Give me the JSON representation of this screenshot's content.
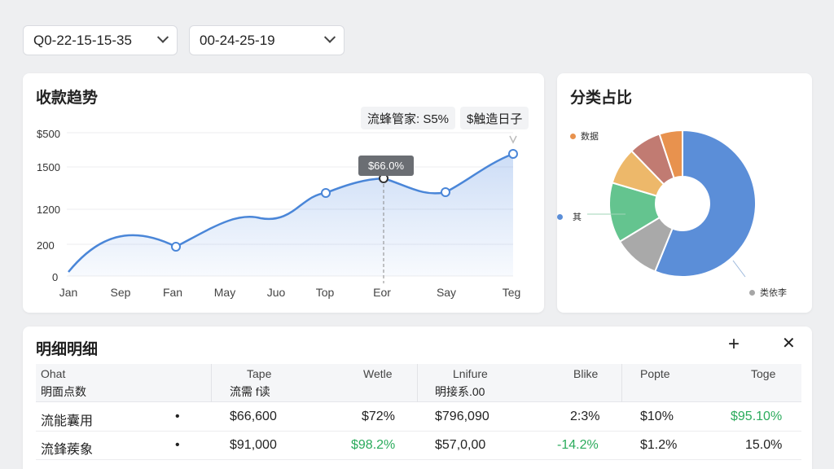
{
  "filters": [
    {
      "value": "Q0-22-15-15-35"
    },
    {
      "value": "00-24-25-19"
    }
  ],
  "trend_card": {
    "title": "收款趋势",
    "pill_ratio": "流蜂管家: S5%",
    "pill_date": "$触造日子",
    "tooltip": "$66.0%"
  },
  "pie_card": {
    "title": "分类占比",
    "legend": [
      {
        "label": "数据",
        "color": "#e8924e"
      },
      {
        "label": "其",
        "color": "#5b8ed8"
      },
      {
        "label": "类依李",
        "color": "#a6a6a6"
      }
    ]
  },
  "chart_data": [
    {
      "type": "area",
      "title": "收款趋势",
      "y_ticks": [
        "$500",
        "1500",
        "1200",
        "200",
        "0"
      ],
      "categories": [
        "Jan",
        "Sep",
        "Fan",
        "May",
        "Juo",
        "Top",
        "Eor",
        "Say",
        "Teg"
      ],
      "series": [
        {
          "values": [
            0,
            580,
            480,
            820,
            860,
            1340,
            1420,
            1370,
            1680
          ]
        }
      ]
    },
    {
      "type": "pie",
      "title": "分类占比",
      "slices": [
        {
          "value": 55,
          "color": "#5b8ed8"
        },
        {
          "value": 10,
          "color": "#a9a9a9"
        },
        {
          "value": 13,
          "color": "#64c48f"
        },
        {
          "value": 8,
          "color": "#edb86a"
        },
        {
          "value": 7,
          "color": "#c17b72"
        },
        {
          "value": 5,
          "color": "#e8924e"
        }
      ]
    }
  ],
  "table": {
    "title": "明细明细",
    "headers": [
      {
        "top": "Ohat",
        "bottom": "明面点数"
      },
      {
        "top": "Tape",
        "bottom": "流需 f读"
      },
      {
        "top": "Wetle",
        "bottom": ""
      },
      {
        "top": "Lnifure",
        "bottom": "明接系.00"
      },
      {
        "top": "Blike",
        "bottom": ""
      },
      {
        "top": "Popte",
        "bottom": ""
      },
      {
        "top": "Toge",
        "bottom": ""
      }
    ],
    "rows": [
      {
        "name": "流能囊用",
        "dot": "•",
        "amount": "$66,600",
        "c2": "$72%",
        "c3": "$796,090",
        "c4": "2:3%",
        "c5": "$10%",
        "c6": "$95.10%"
      },
      {
        "name": "流鋒蒺象",
        "dot": "•",
        "amount": "$91,000",
        "c2": "$98.2%",
        "c3": "$57,0,00",
        "c4": "-14.2%",
        "c5": "$1.2%",
        "c6": "15.0%"
      }
    ]
  }
}
